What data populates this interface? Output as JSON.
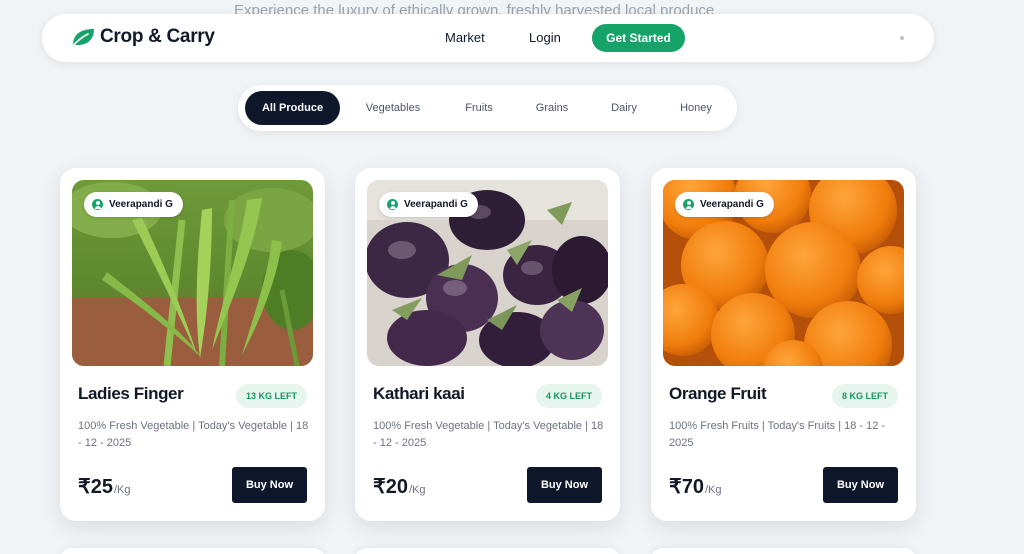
{
  "tagline": "Experience the luxury of ethically grown, freshly harvested local produce",
  "brand": {
    "name": "Crop & Carry",
    "icon": "leaf-icon",
    "color": "#16a36a"
  },
  "nav": {
    "market": "Market",
    "login": "Login",
    "get_started": "Get Started"
  },
  "tabs": [
    {
      "label": "All Produce",
      "active": true
    },
    {
      "label": "Vegetables",
      "active": false
    },
    {
      "label": "Fruits",
      "active": false
    },
    {
      "label": "Grains",
      "active": false
    },
    {
      "label": "Dairy",
      "active": false
    },
    {
      "label": "Honey",
      "active": false
    }
  ],
  "products": [
    {
      "seller": "Veerapandi G",
      "name": "Ladies Finger",
      "stock": "13 KG LEFT",
      "description": "100% Fresh Vegetable | Today's Vegetable | 18 - 12 - 2025",
      "price": "₹25",
      "unit": "/Kg",
      "buy_label": "Buy Now"
    },
    {
      "seller": "Veerapandi G",
      "name": "Kathari kaai",
      "stock": "4 KG LEFT",
      "description": "100% Fresh Vegetable | Today's Vegetable | 18 - 12 - 2025",
      "price": "₹20",
      "unit": "/Kg",
      "buy_label": "Buy Now"
    },
    {
      "seller": "Veerapandi G",
      "name": "Orange Fruit",
      "stock": "8 KG LEFT",
      "description": "100% Fresh Fruits | Today's Fruits | 18 - 12 - 2025",
      "price": "₹70",
      "unit": "/Kg",
      "buy_label": "Buy Now"
    }
  ],
  "colors": {
    "accent": "#16a36a",
    "dark": "#0f172a",
    "stock_bg": "#e6f6ee"
  }
}
